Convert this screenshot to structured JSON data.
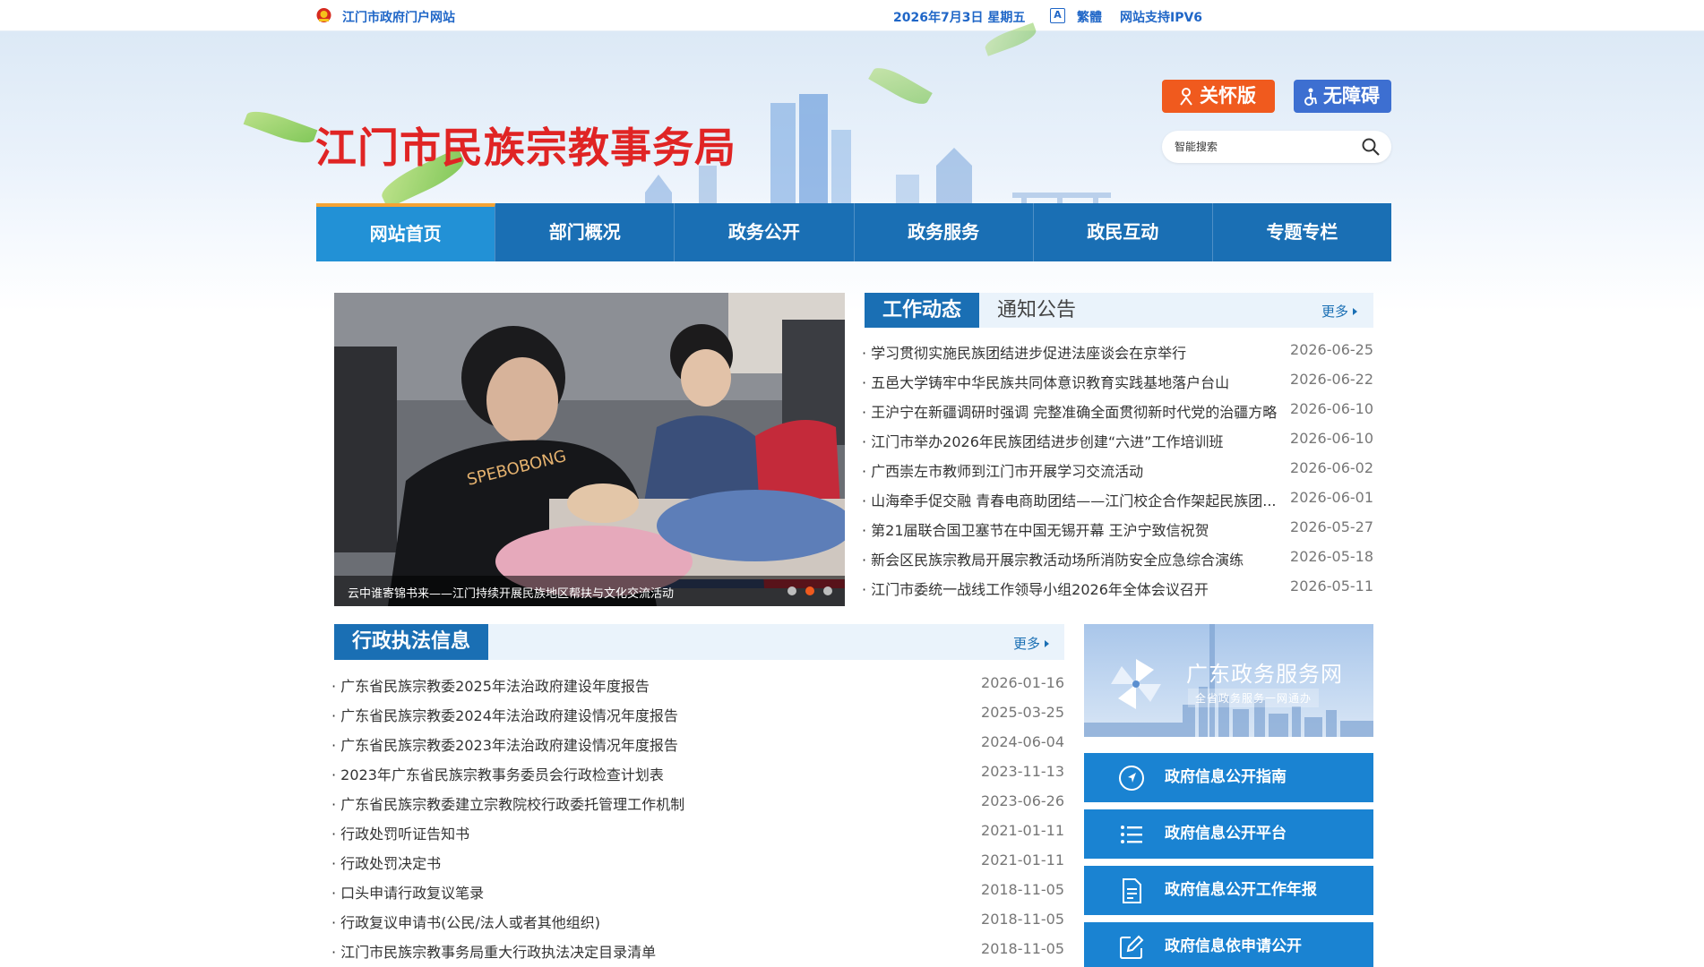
{
  "topbar": {
    "gov_portal": "江门市政府门户网站",
    "date": "2026年7月3日 星期五",
    "traditional": "繁體",
    "ipv6": "网站支持IPV6"
  },
  "header": {
    "site_title": "江门市民族宗教事务局",
    "care_button": "关怀版",
    "accessibility_button": "无障碍",
    "search_placeholder": "智能搜索"
  },
  "nav": {
    "items": [
      {
        "label": "网站首页"
      },
      {
        "label": "部门概况"
      },
      {
        "label": "政务公开"
      },
      {
        "label": "政务服务"
      },
      {
        "label": "政民互动"
      },
      {
        "label": "专题专栏"
      }
    ]
  },
  "slider": {
    "caption": "云中谁寄锦书来——江门持续开展民族地区帮扶与文化交流活动",
    "shirt_text": "SPEBOBONG"
  },
  "news": {
    "active_tab": "工作动态",
    "inactive_tab": "通知公告",
    "more": "更多",
    "items": [
      {
        "title": "学习贯彻实施民族团结进步促进法座谈会在京举行",
        "date": "2026-06-25"
      },
      {
        "title": "五邑大学铸牢中华民族共同体意识教育实践基地落户台山",
        "date": "2026-06-22"
      },
      {
        "title": "王沪宁在新疆调研时强调 完整准确全面贯彻新时代党的治疆方略",
        "date": "2026-06-10"
      },
      {
        "title": "江门市举办2026年民族团结进步创建“六进”工作培训班",
        "date": "2026-06-10"
      },
      {
        "title": "广西崇左市教师到江门市开展学习交流活动",
        "date": "2026-06-02"
      },
      {
        "title": "山海牵手促交融 青春电商助团结——江门校企合作架起民族团...",
        "date": "2026-06-01"
      },
      {
        "title": "第21届联合国卫塞节在中国无锡开幕 王沪宁致信祝贺",
        "date": "2026-05-27"
      },
      {
        "title": "新会区民族宗教局开展宗教活动场所消防安全应急综合演练",
        "date": "2026-05-18"
      },
      {
        "title": "江门市委统一战线工作领导小组2026年全体会议召开",
        "date": "2026-05-11"
      }
    ]
  },
  "law": {
    "title": "行政执法信息",
    "more": "更多",
    "items": [
      {
        "title": "广东省民族宗教委2025年法治政府建设年度报告",
        "date": "2026-01-16"
      },
      {
        "title": "广东省民族宗教委2024年法治政府建设情况年度报告",
        "date": "2025-03-25"
      },
      {
        "title": "广东省民族宗教委2023年法治政府建设情况年度报告",
        "date": "2024-06-04"
      },
      {
        "title": "2023年广东省民族宗教事务委员会行政检查计划表",
        "date": "2023-11-13"
      },
      {
        "title": "广东省民族宗教委建立宗教院校行政委托管理工作机制",
        "date": "2023-06-26"
      },
      {
        "title": "行政处罚听证告知书",
        "date": "2021-01-11"
      },
      {
        "title": "行政处罚决定书",
        "date": "2021-01-11"
      },
      {
        "title": "口头申请行政复议笔录",
        "date": "2018-11-05"
      },
      {
        "title": "行政复议申请书(公民/法人或者其他组织)",
        "date": "2018-11-05"
      },
      {
        "title": "江门市民族宗教事务局重大行政执法决定目录清单",
        "date": "2018-11-05"
      }
    ]
  },
  "right": {
    "gd_title": "广东政务服务网",
    "gd_subtitle": "全省政务服务一网通办",
    "services": [
      {
        "label": "政府信息公开指南",
        "icon": "navigation-icon"
      },
      {
        "label": "政府信息公开平台",
        "icon": "list-icon"
      },
      {
        "label": "政府信息公开工作年报",
        "icon": "document-icon"
      },
      {
        "label": "政府信息依申请公开",
        "icon": "edit-icon"
      }
    ]
  },
  "colors": {
    "primary": "#1a6fb4",
    "title_red": "#e02424",
    "care_orange": "#f05a1e",
    "accessibility_blue": "#3d6fd1",
    "nav_active": "#2291d6"
  }
}
